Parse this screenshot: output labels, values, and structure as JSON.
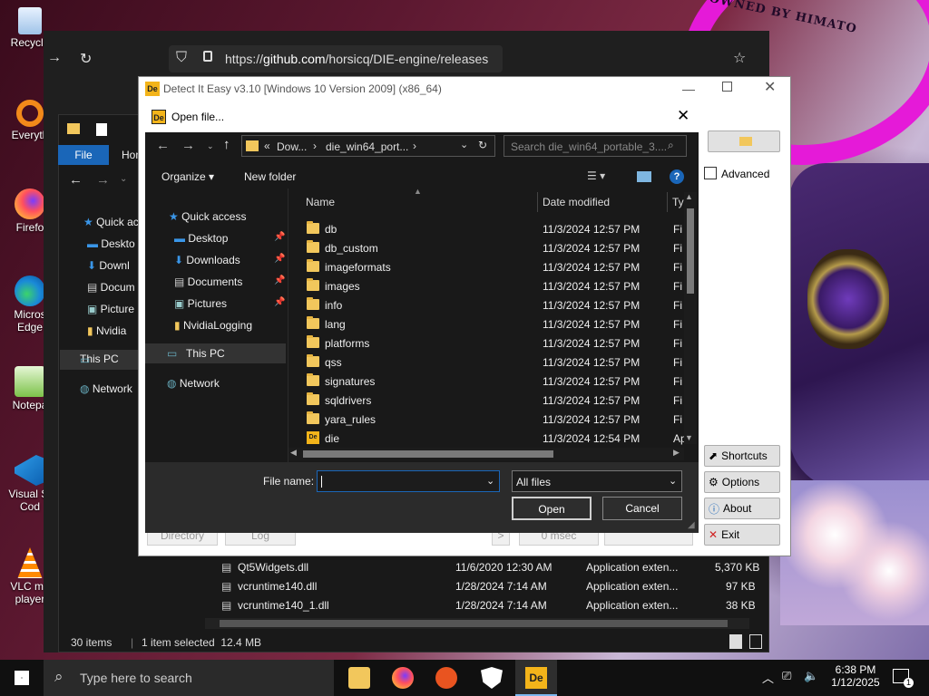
{
  "wallpaper": {
    "text": "OWNED BY HIMATO"
  },
  "desktop_icons": [
    {
      "label": "Recycle",
      "icon": "recycle-bin-icon"
    },
    {
      "label": "Everyth",
      "icon": "everything-search-icon"
    },
    {
      "label": "Firefo",
      "icon": "firefox-icon"
    },
    {
      "label": "Micros",
      "label2": "Edge",
      "icon": "edge-icon"
    },
    {
      "label": "Notepa",
      "icon": "notepad-plus-icon"
    },
    {
      "label": "Visual St",
      "label2": "Cod",
      "icon": "vscode-icon"
    },
    {
      "label": "VLC me",
      "label2": "player",
      "icon": "vlc-icon"
    }
  ],
  "browser": {
    "url_prefix": "https://",
    "url_host": "github.com",
    "url_path": "/horsicq/DIE-engine/releases"
  },
  "explorer": {
    "tab_file": "File",
    "tab_home": "Hom",
    "sidebar": [
      "Quick ac",
      "Deskto",
      "Downl",
      "Docum",
      "Picture",
      "Nvidia",
      "This PC",
      "Network"
    ],
    "rows": [
      {
        "name": "Qt5Widgets.dll",
        "date": "11/6/2020 12:30 AM",
        "type": "Application exten...",
        "size": "5,370 KB"
      },
      {
        "name": "vcruntime140.dll",
        "date": "1/28/2024 7:14 AM",
        "type": "Application exten...",
        "size": "97 KB"
      },
      {
        "name": "vcruntime140_1.dll",
        "date": "1/28/2024 7:14 AM",
        "type": "Application exten...",
        "size": "38 KB"
      }
    ],
    "status_items": "30 items",
    "status_selected": "1 item selected  12.4 MB"
  },
  "die": {
    "title": "Detect It Easy v3.10 [Windows 10 Version 2009] (x86_64)",
    "advanced_label": "Advanced",
    "buttons": {
      "shortcuts": "Shortcuts",
      "options": "Options",
      "about": "About",
      "exit": "Exit"
    },
    "bottom": {
      "directory": "Directory",
      "log": "Log",
      "arrow": ">",
      "time": "0 msec"
    }
  },
  "dialog": {
    "title": "Open file...",
    "breadcrumb_prefix": "«",
    "breadcrumb_1": "Dow...",
    "breadcrumb_sep": "›",
    "breadcrumb_2": "die_win64_port...",
    "search_placeholder": "Search die_win64_portable_3....",
    "organize": "Organize",
    "new_folder": "New folder",
    "nav": [
      {
        "label": "Quick access",
        "icon": "star-icon",
        "pinned": false
      },
      {
        "label": "Desktop",
        "icon": "desktop-icon",
        "pinned": true
      },
      {
        "label": "Downloads",
        "icon": "download-icon",
        "pinned": true
      },
      {
        "label": "Documents",
        "icon": "document-icon",
        "pinned": true
      },
      {
        "label": "Pictures",
        "icon": "pictures-icon",
        "pinned": true
      },
      {
        "label": "NvidiaLogging",
        "icon": "folder-icon",
        "pinned": false
      },
      {
        "label": "This PC",
        "icon": "computer-icon",
        "pinned": false
      },
      {
        "label": "Network",
        "icon": "network-icon",
        "pinned": false
      }
    ],
    "columns": {
      "name": "Name",
      "date": "Date modified",
      "type": "Ty"
    },
    "files": [
      {
        "name": "db",
        "date": "11/3/2024 12:57 PM",
        "type": "Fi"
      },
      {
        "name": "db_custom",
        "date": "11/3/2024 12:57 PM",
        "type": "Fi"
      },
      {
        "name": "imageformats",
        "date": "11/3/2024 12:57 PM",
        "type": "Fi"
      },
      {
        "name": "images",
        "date": "11/3/2024 12:57 PM",
        "type": "Fi"
      },
      {
        "name": "info",
        "date": "11/3/2024 12:57 PM",
        "type": "Fi"
      },
      {
        "name": "lang",
        "date": "11/3/2024 12:57 PM",
        "type": "Fi"
      },
      {
        "name": "platforms",
        "date": "11/3/2024 12:57 PM",
        "type": "Fi"
      },
      {
        "name": "qss",
        "date": "11/3/2024 12:57 PM",
        "type": "Fi"
      },
      {
        "name": "signatures",
        "date": "11/3/2024 12:57 PM",
        "type": "Fi"
      },
      {
        "name": "sqldrivers",
        "date": "11/3/2024 12:57 PM",
        "type": "Fi"
      },
      {
        "name": "yara_rules",
        "date": "11/3/2024 12:57 PM",
        "type": "Fi"
      },
      {
        "name": "die",
        "date": "11/3/2024 12:54 PM",
        "type": "Ap"
      }
    ],
    "file_name_label": "File name:",
    "file_name_value": "",
    "filter_value": "All files",
    "open_button": "Open",
    "cancel_button": "Cancel"
  },
  "taskbar": {
    "search_placeholder": "Type here to search",
    "time": "6:38 PM",
    "date": "1/12/2025",
    "notifications": "1"
  },
  "colors": {
    "accent": "#1a66b8",
    "folder": "#f2c75c",
    "ring": "#e51ad8",
    "dark_bg": "#191919"
  }
}
